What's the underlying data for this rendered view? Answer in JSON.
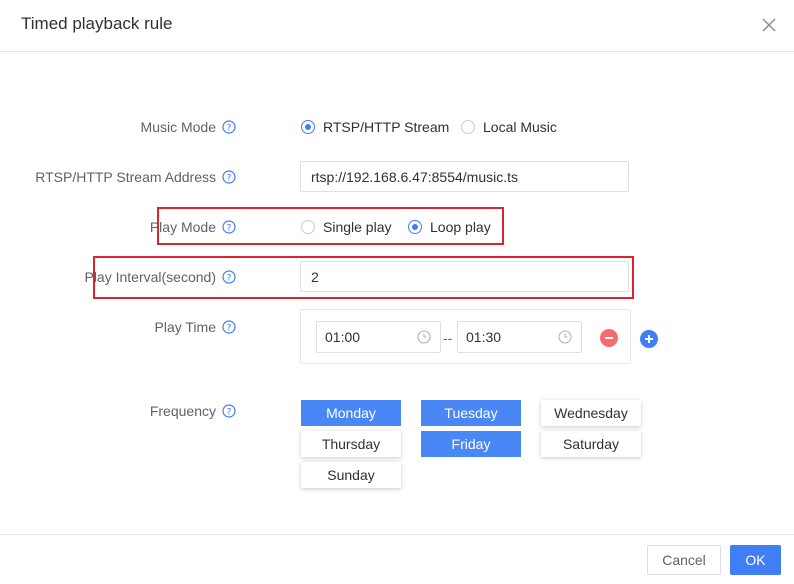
{
  "dialog": {
    "title": "Timed playback rule"
  },
  "form": {
    "music_mode": {
      "label": "Music Mode",
      "options": [
        "RTSP/HTTP Stream",
        "Local Music"
      ],
      "selected": "RTSP/HTTP Stream"
    },
    "stream_address": {
      "label": "RTSP/HTTP Stream Address",
      "value": "rtsp://192.168.6.47:8554/music.ts"
    },
    "play_mode": {
      "label": "Play Mode",
      "options": [
        "Single play",
        "Loop play"
      ],
      "selected": "Loop play"
    },
    "play_interval": {
      "label": "Play Interval(second)",
      "value": "2"
    },
    "play_time": {
      "label": "Play Time",
      "start": "01:00",
      "separator": "--",
      "end": "01:30"
    },
    "frequency": {
      "label": "Frequency",
      "days": [
        {
          "label": "Monday",
          "selected": true
        },
        {
          "label": "Tuesday",
          "selected": true
        },
        {
          "label": "Wednesday",
          "selected": false
        },
        {
          "label": "Thursday",
          "selected": false
        },
        {
          "label": "Friday",
          "selected": true
        },
        {
          "label": "Saturday",
          "selected": false
        },
        {
          "label": "Sunday",
          "selected": false
        }
      ]
    }
  },
  "footer": {
    "cancel_label": "Cancel",
    "ok_label": "OK"
  },
  "colors": {
    "accent": "#3f7ef5",
    "highlight_box": "#d9252e",
    "remove_button": "#f56c6c"
  },
  "icons": [
    "close-icon",
    "help-icon",
    "clock-icon",
    "remove-icon",
    "add-icon"
  ]
}
